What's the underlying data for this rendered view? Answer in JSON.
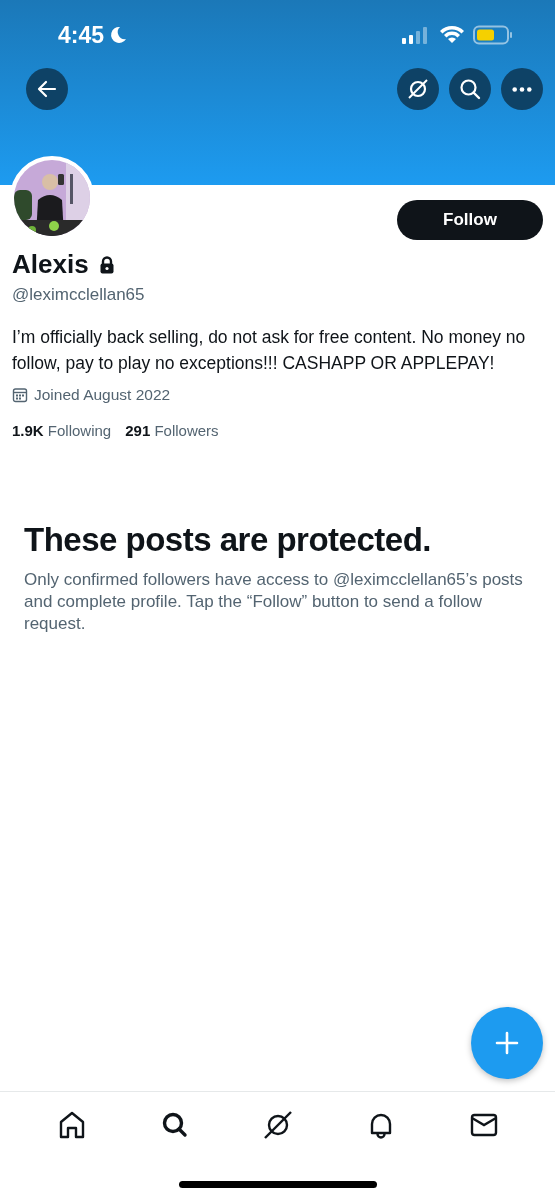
{
  "status_bar": {
    "time": "4:45"
  },
  "header": {
    "buttons": [
      {
        "kind": "back"
      },
      {
        "kind": "grok"
      },
      {
        "kind": "search"
      },
      {
        "kind": "more"
      }
    ]
  },
  "profile": {
    "follow_button": "Follow",
    "name": "Alexis",
    "protected": true,
    "handle": "@leximcclellan65",
    "bio": "I’m officially back selling, do not ask for free content. No money no follow, pay to play no exceptions!!! CASHAPP OR APPLEPAY!",
    "joined": "Joined August 2022",
    "following_count": "1.9K",
    "following_label": "Following",
    "followers_count": "291",
    "followers_label": "Followers"
  },
  "protected_notice": {
    "title": "These posts are protected.",
    "text": "Only confirmed followers have access to @leximcclellan65’s posts and complete profile. Tap the “Follow” button to send a follow request."
  },
  "nav": [
    {
      "kind": "home",
      "selected": false
    },
    {
      "kind": "search",
      "selected": true
    },
    {
      "kind": "grok",
      "selected": false
    },
    {
      "kind": "notifications",
      "selected": false
    },
    {
      "kind": "messages",
      "selected": false
    }
  ]
}
